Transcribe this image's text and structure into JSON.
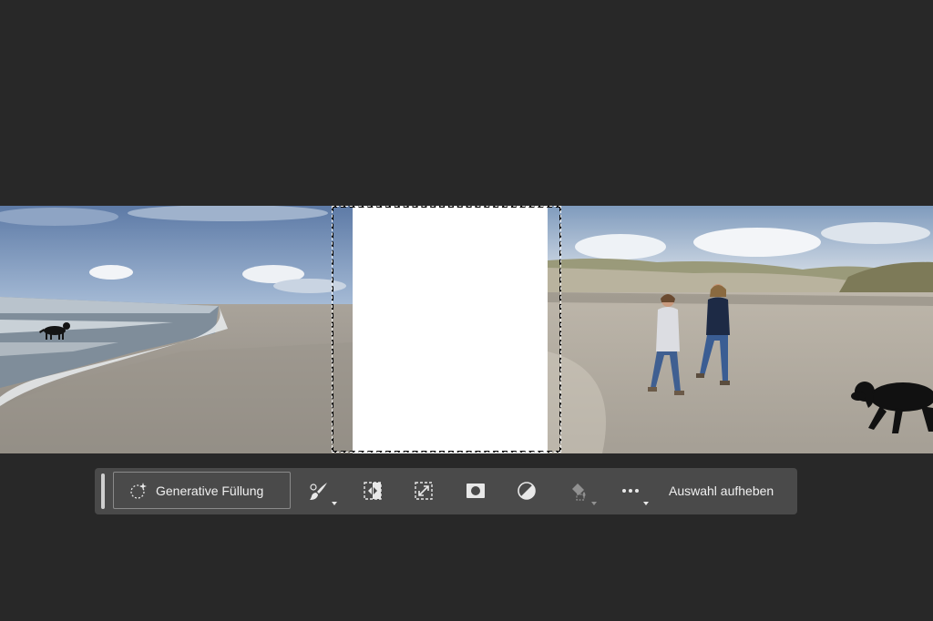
{
  "canvas": {
    "background_color": "#282828"
  },
  "image": {
    "left_photo_icon": "beach-photo-with-dog-in-surf",
    "right_photo_icon": "beach-photo-with-two-people-and-dog",
    "selection_fill_color": "#ffffff"
  },
  "taskbar": {
    "background_color": "#4a4a4a",
    "generative_fill_label": "Generative Füllung",
    "generative_fill_icon": "sparkle-circle-icon",
    "tools": [
      {
        "name": "brush-modify-icon",
        "has_menu": true,
        "enabled": true
      },
      {
        "name": "invert-selection-icon",
        "has_menu": false,
        "enabled": true
      },
      {
        "name": "transform-selection-icon",
        "has_menu": false,
        "enabled": true
      },
      {
        "name": "create-mask-icon",
        "has_menu": false,
        "enabled": true
      },
      {
        "name": "adjustment-layer-icon",
        "has_menu": false,
        "enabled": true
      },
      {
        "name": "fill-selection-icon",
        "has_menu": true,
        "enabled": false
      },
      {
        "name": "more-options-icon",
        "has_menu": true,
        "enabled": true
      }
    ],
    "deselect_label": "Auswahl aufheben"
  }
}
